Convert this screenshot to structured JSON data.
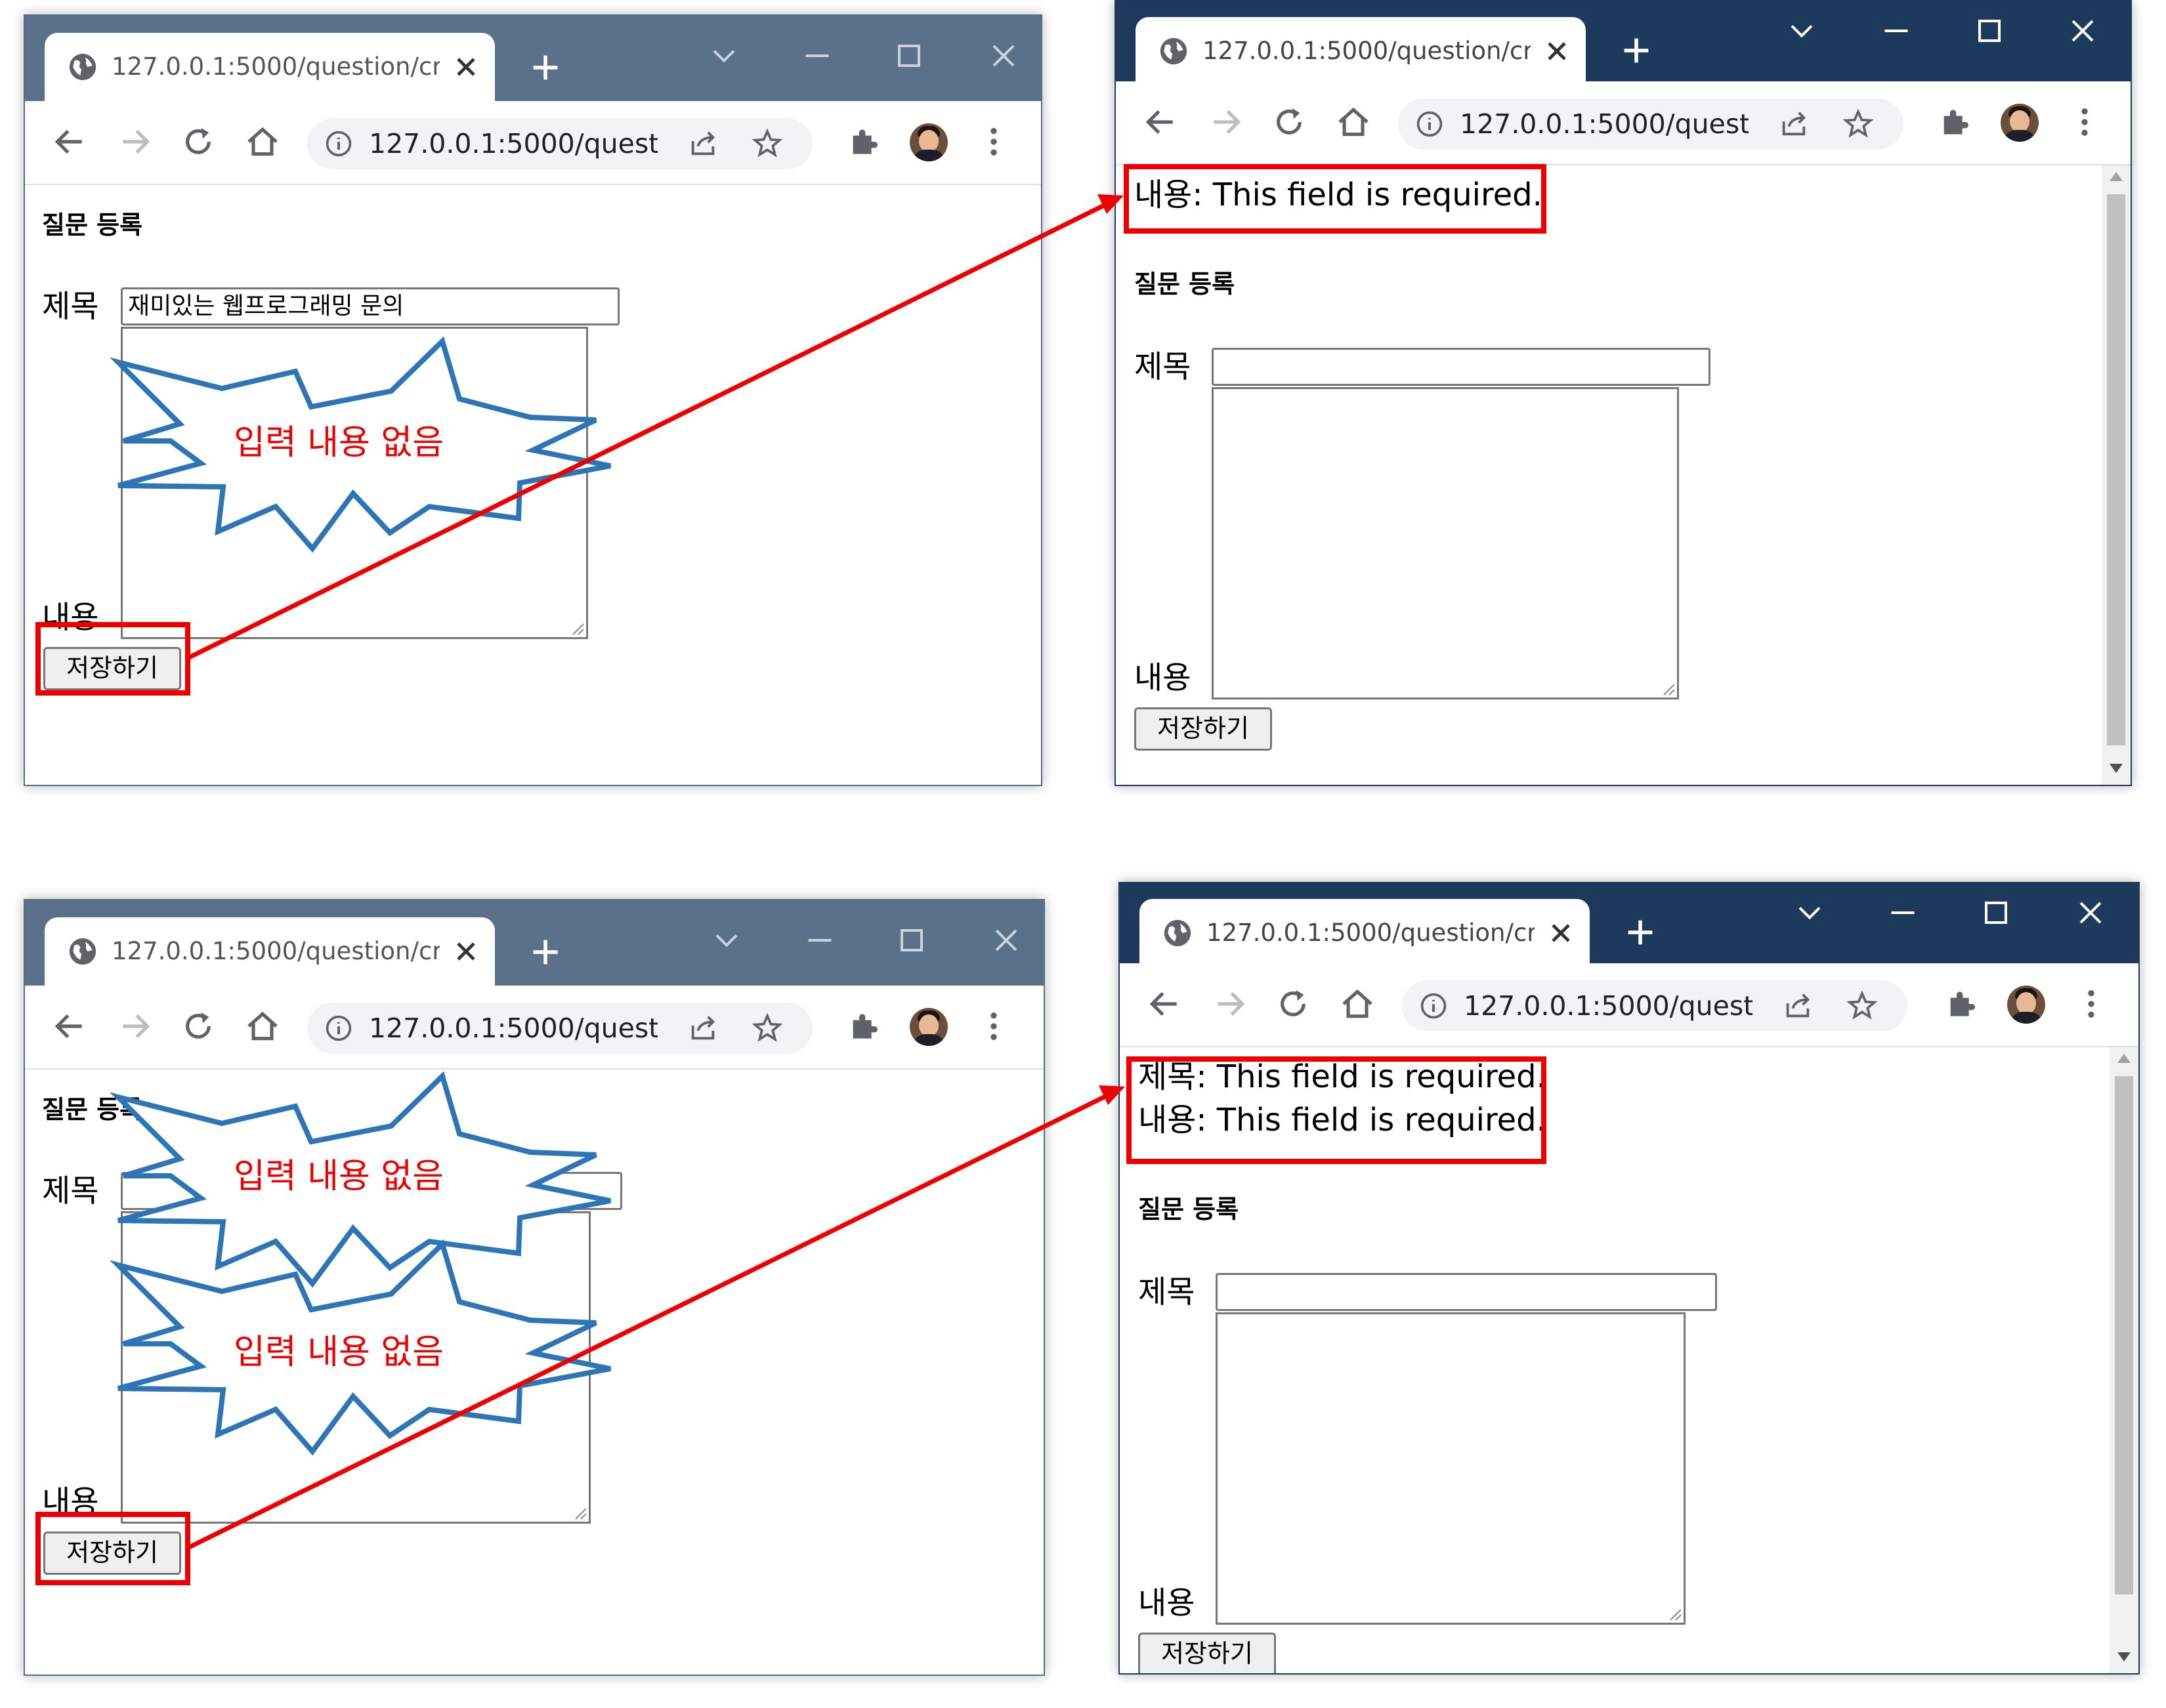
{
  "browser": {
    "tab_title": "127.0.0.1:5000/question/creat",
    "url": "127.0.0.1:5000/questi..."
  },
  "form": {
    "heading": "질문 등록",
    "subject_label": "제목",
    "content_label": "내용",
    "save_button": "저장하기"
  },
  "panels": {
    "top_left": {
      "subject_value": "재미있는 웹프로그래밍 문의"
    },
    "top_right": {
      "errors": [
        "내용: This field is required."
      ]
    },
    "bottom_left": {
      "subject_value": ""
    },
    "bottom_right": {
      "errors": [
        "제목: This field is required.",
        "내용: This field is required."
      ]
    }
  },
  "annotations": {
    "burst_label": "입력 내용 없음",
    "highlight_color": "#ee0000",
    "burst_color": "#2e75b6"
  }
}
